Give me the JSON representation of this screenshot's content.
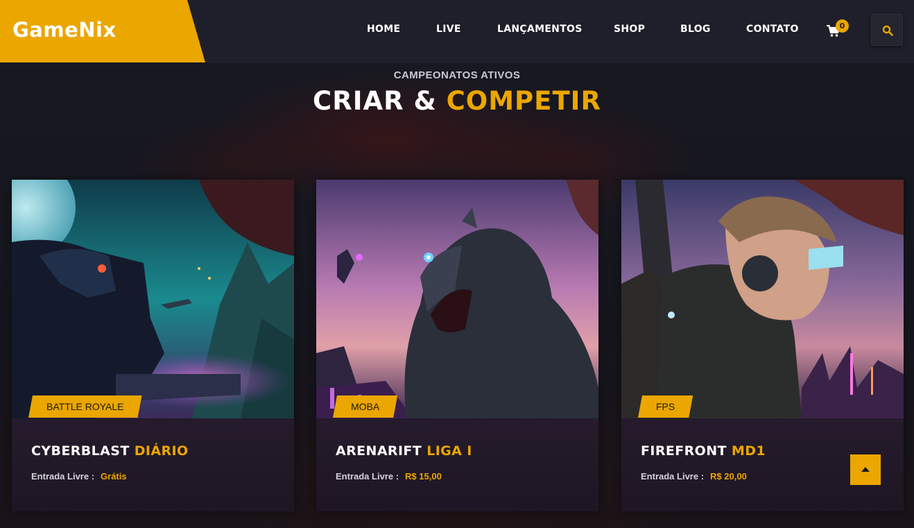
{
  "brand": {
    "name": "GameNix",
    "color": "#eba600"
  },
  "nav": [
    {
      "label": "HOME"
    },
    {
      "label": "LIVE"
    },
    {
      "label": "LANÇAMENTOS"
    },
    {
      "label": "SHOP"
    },
    {
      "label": "BLOG"
    },
    {
      "label": "CONTATO"
    }
  ],
  "cart": {
    "count": "0",
    "icon": "cart-icon"
  },
  "search": {
    "icon": "search-icon"
  },
  "section": {
    "subtitle": "CAMPEONATOS ATIVOS",
    "title_white": "CRIAR &",
    "title_accent": "COMPETIR"
  },
  "cards": [
    {
      "tag": "BATTLE ROYALE",
      "title_white": "CYBERBLAST",
      "title_accent": "DIÁRIO",
      "entry_label": "Entrada Livre :",
      "entry_value": "Grátis"
    },
    {
      "tag": "MOBA",
      "title_white": "ARENARIFT",
      "title_accent": "LIGA I",
      "entry_label": "Entrada Livre :",
      "entry_value": "R$ 15,00"
    },
    {
      "tag": "FPS",
      "title_white": "FIREFRONT",
      "title_accent": "MD1",
      "entry_label": "Entrada Livre :",
      "entry_value": "R$ 20,00"
    }
  ],
  "scroll_top": {
    "icon": "arrow-up-icon"
  }
}
